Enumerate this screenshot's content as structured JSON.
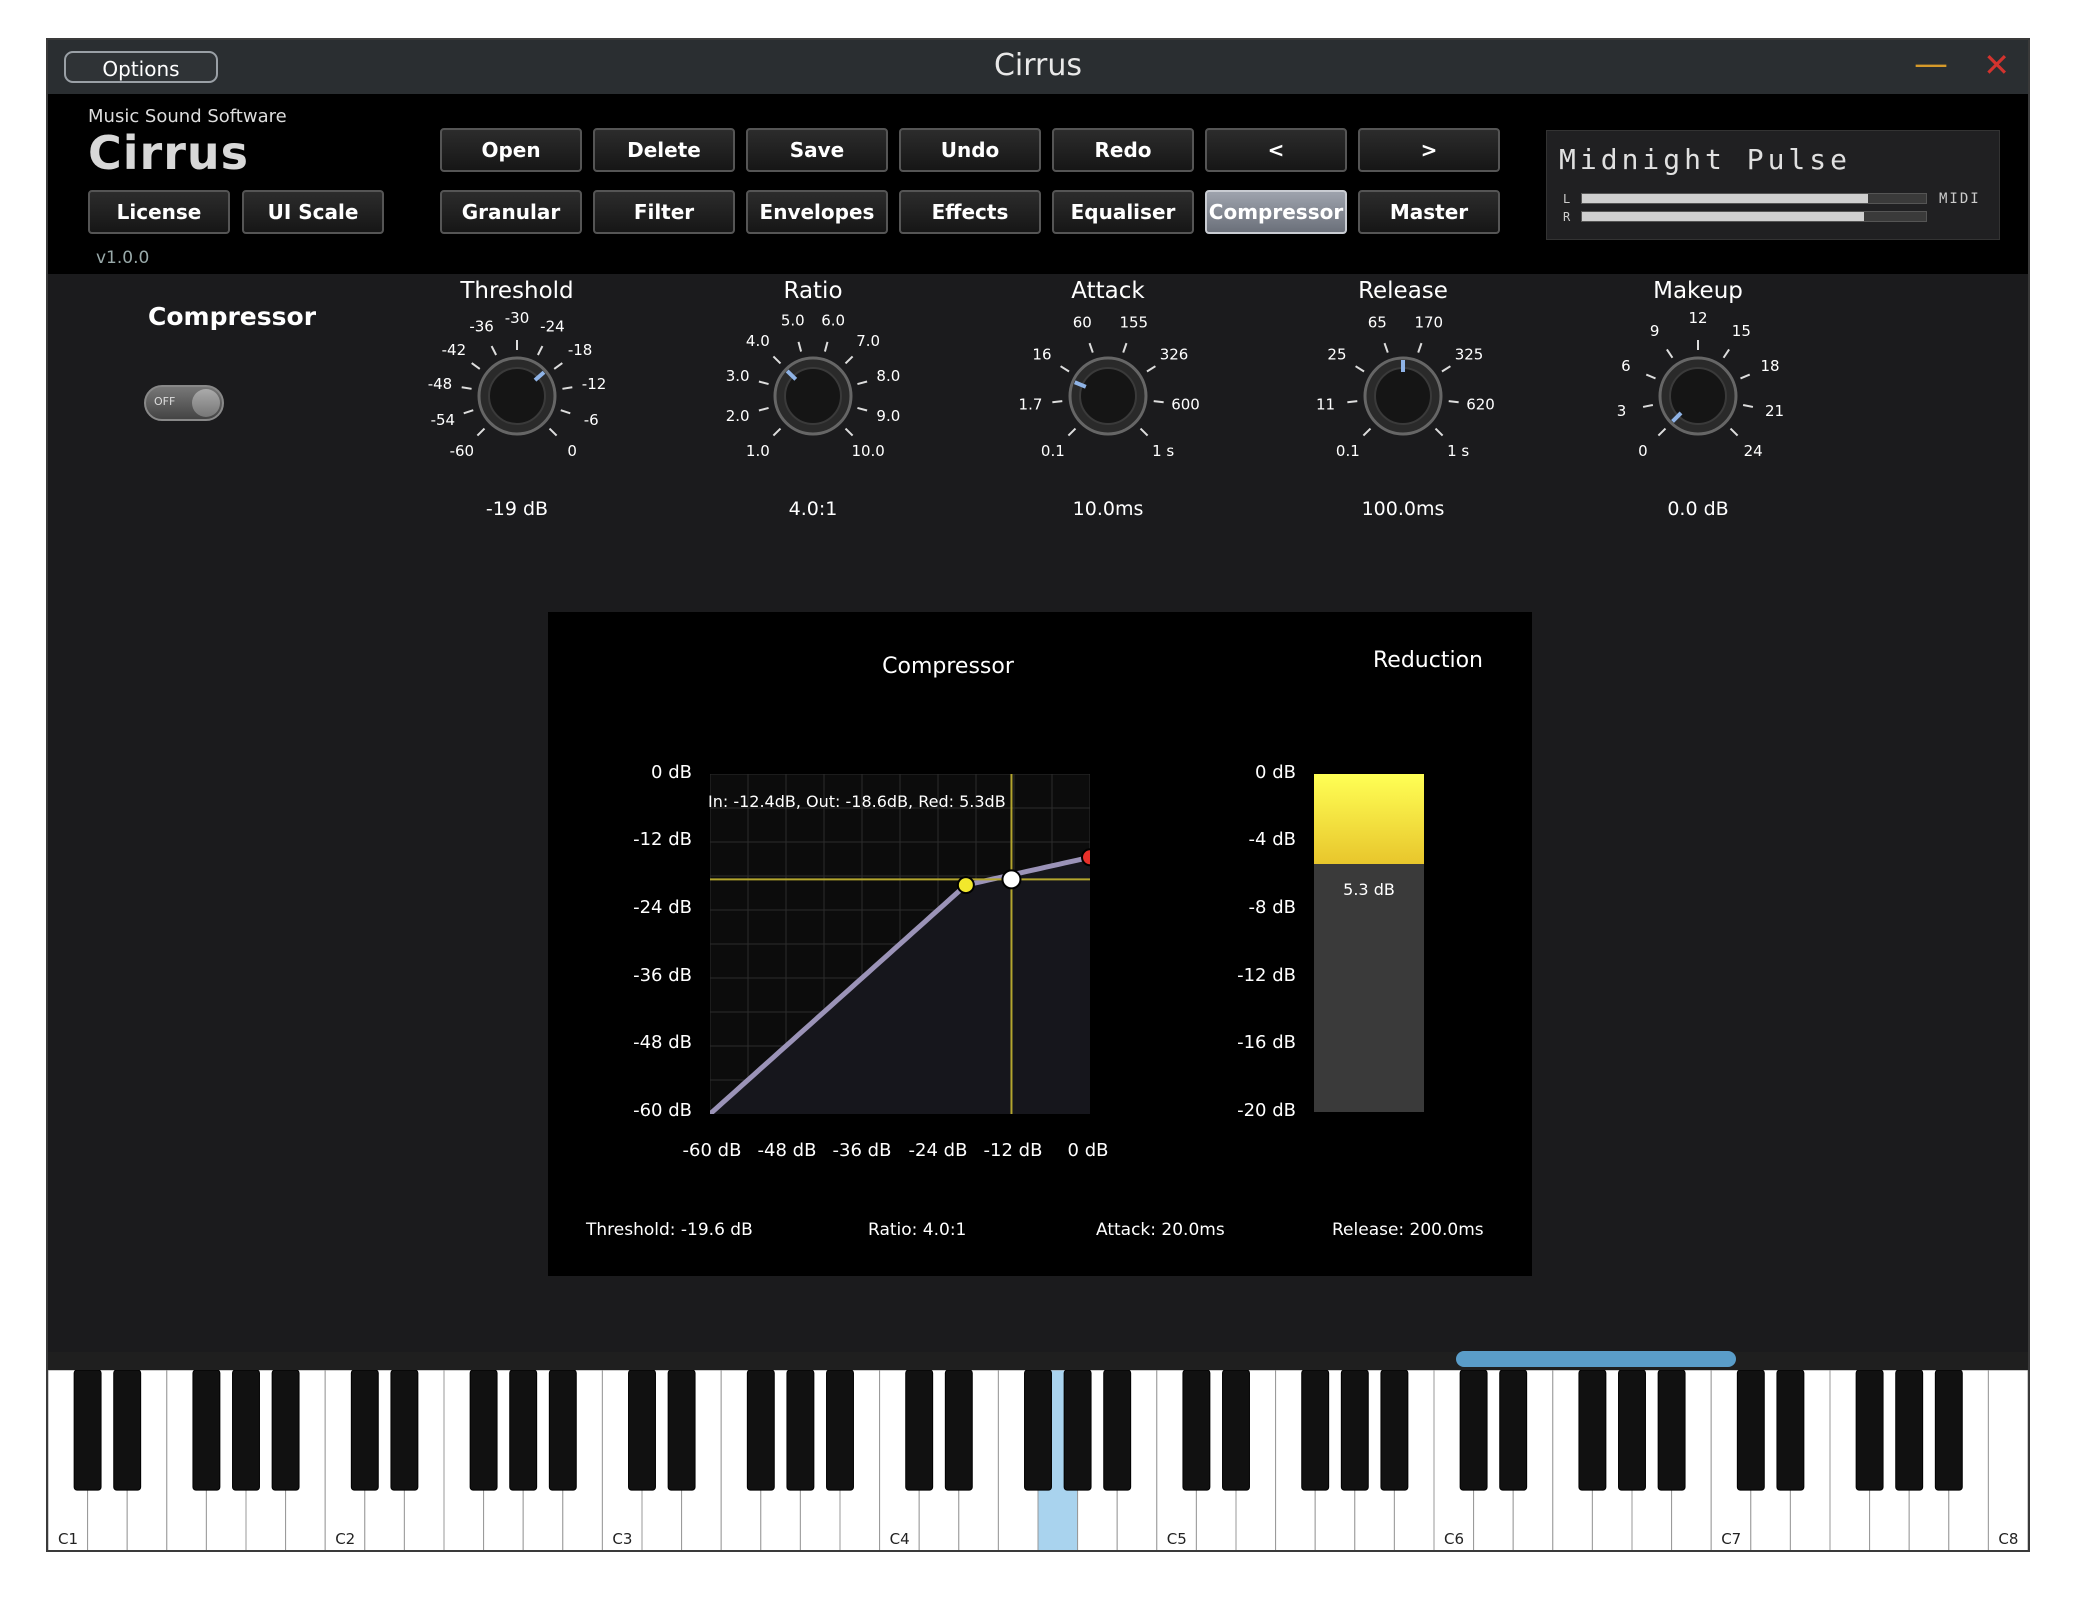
{
  "window": {
    "title": "Cirrus",
    "options_label": "Options",
    "minimize_glyph": "—",
    "close_glyph": "✕"
  },
  "brand": {
    "company": "Music Sound Software",
    "logo": "Cirrus",
    "version": "v1.0.0"
  },
  "left_buttons": [
    "License",
    "UI Scale"
  ],
  "toolbar": [
    "Open",
    "Delete",
    "Save",
    "Undo",
    "Redo",
    "<",
    ">"
  ],
  "nav": [
    "Granular",
    "Filter",
    "Envelopes",
    "Effects",
    "Equaliser",
    "Compressor",
    "Master"
  ],
  "active_nav": "Compressor",
  "preset": {
    "name": "Midnight Pulse",
    "meter_l_label": "L",
    "meter_r_label": "R",
    "meter_l": 0.83,
    "meter_r": 0.82,
    "midi_label": "MIDI"
  },
  "section": {
    "title": "Compressor",
    "power_label": "OFF",
    "power_on": false
  },
  "knobs": [
    {
      "title": "Threshold",
      "value": "-19 dB",
      "position": 0.68,
      "ticks": [
        "-60",
        "-54",
        "-48",
        "-42",
        "-36",
        "-30",
        "-24",
        "-18",
        "-12",
        "-6",
        "0"
      ]
    },
    {
      "title": "Ratio",
      "value": "4.0:1",
      "position": 0.33,
      "ticks": [
        "1.0",
        "2.0",
        "3.0",
        "4.0",
        "5.0",
        "6.0",
        "7.0",
        "8.0",
        "9.0",
        "10.0"
      ]
    },
    {
      "title": "Attack",
      "value": "10.0ms",
      "position": 0.25,
      "ticks": [
        "0.1",
        "1.7",
        "16",
        "60",
        "155",
        "326",
        "600",
        "1 s"
      ]
    },
    {
      "title": "Release",
      "value": "100.0ms",
      "position": 0.5,
      "ticks": [
        "0.1",
        "11",
        "25",
        "65",
        "170",
        "325",
        "620",
        "1 s"
      ]
    },
    {
      "title": "Makeup",
      "value": "0.0 dB",
      "position": 0.0,
      "ticks": [
        "0",
        "3",
        "6",
        "9",
        "12",
        "15",
        "18",
        "21",
        "24"
      ]
    }
  ],
  "graph": {
    "title": "Compressor",
    "y_labels": [
      "0 dB",
      "-12 dB",
      "-24 dB",
      "-36 dB",
      "-48 dB",
      "-60 dB"
    ],
    "x_labels": [
      "-60 dB",
      "-48 dB",
      "-36 dB",
      "-24 dB",
      "-12 dB",
      "0 dB"
    ],
    "readout": "In: -12.4dB, Out: -18.6dB, Red: 5.3dB",
    "threshold_db": -19.6,
    "ratio": 4.0,
    "cursor_in_db": -12.4,
    "cursor_out_db": -18.6
  },
  "reduction": {
    "title": "Reduction",
    "labels": [
      "0 dB",
      "-4 dB",
      "-8 dB",
      "-12 dB",
      "-16 dB",
      "-20 dB"
    ],
    "value_db": 5.3,
    "value_label": "5.3 dB"
  },
  "stats": {
    "threshold": "Threshold: -19.6 dB",
    "ratio": "Ratio: 4.0:1",
    "attack": "Attack: 20.0ms",
    "release": "Release: 200.0ms"
  },
  "keyboard": {
    "octave_labels": [
      "C1",
      "C2",
      "C3",
      "C4",
      "C5",
      "C6",
      "C7",
      "C8"
    ],
    "pressed_key": "G4"
  },
  "colors": {
    "accent_active": "#9ea3ad",
    "curve": "#9b93b8",
    "threshold_line": "#b3a52e",
    "point_yellow": "#f2e82c",
    "point_red": "#e8302a",
    "key_pressed": "#a9d3ee"
  }
}
